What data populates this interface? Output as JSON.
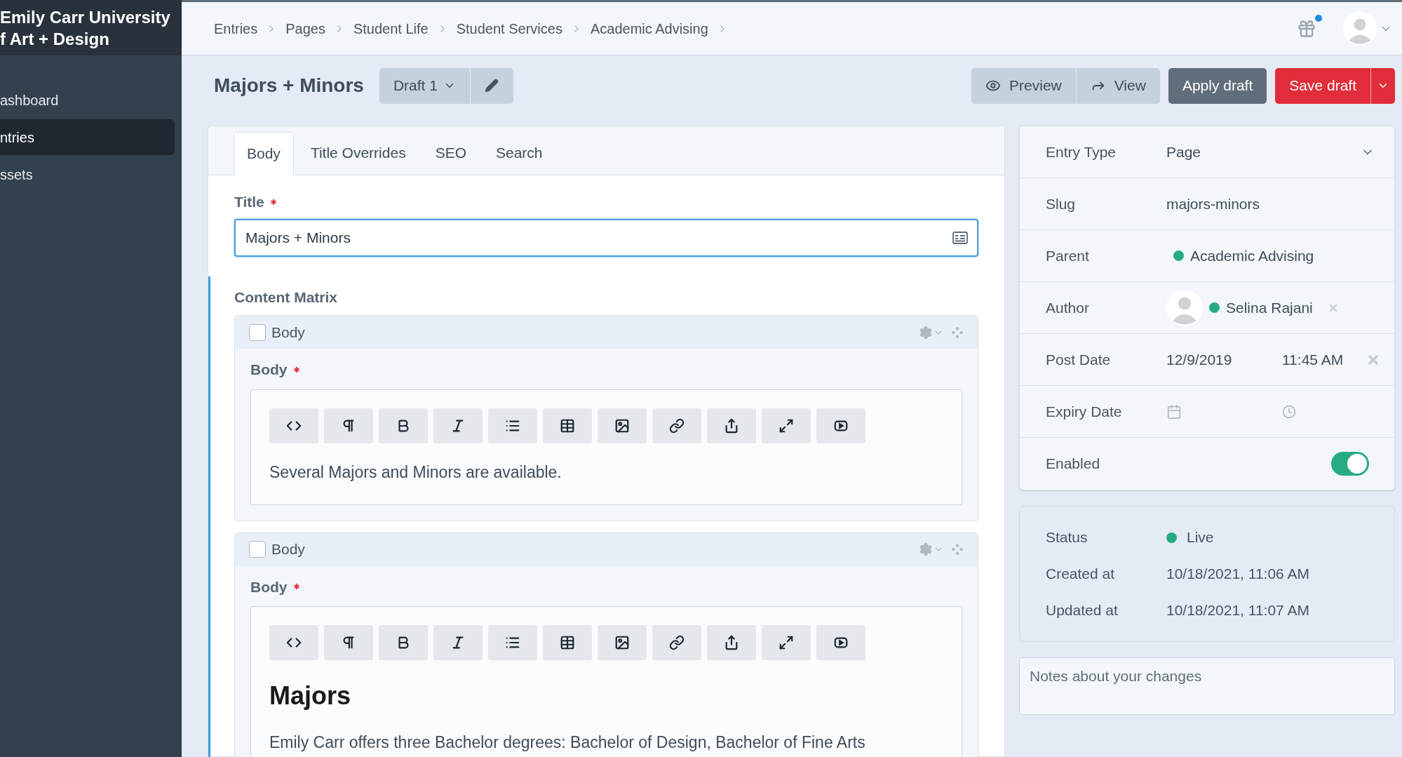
{
  "sidebar": {
    "site_name": [
      "Emily Carr University",
      "f Art + Design"
    ],
    "items": [
      {
        "label": "ashboard",
        "selected": false
      },
      {
        "label": "ntries",
        "selected": true
      },
      {
        "label": "ssets",
        "selected": false
      }
    ]
  },
  "breadcrumbs": [
    "Entries",
    "Pages",
    "Student Life",
    "Student Services",
    "Academic Advising"
  ],
  "entry": {
    "title": "Majors + Minors",
    "draft": "Draft 1"
  },
  "actions": [
    {
      "label": "Preview",
      "kind": "preview"
    },
    {
      "label": "View",
      "kind": "view"
    },
    {
      "label": "Apply draft",
      "kind": "apply"
    },
    {
      "label": "Save draft",
      "kind": "save"
    }
  ],
  "tabs": [
    {
      "label": "Body",
      "selected": true
    },
    {
      "label": "Title Overrides",
      "selected": false
    },
    {
      "label": "SEO",
      "selected": false
    },
    {
      "label": "Search",
      "selected": false
    }
  ],
  "title_field": {
    "label": "Title",
    "required": true,
    "value": "Majors + Minors"
  },
  "content_matrix": {
    "label": "Content Matrix",
    "blocks": [
      {
        "type_label": "Body",
        "checked": false,
        "field_label": "Body",
        "required": true,
        "content": [
          {
            "kind": "paragraph",
            "text": "Several Majors and Minors are available."
          }
        ]
      },
      {
        "type_label": "Body",
        "checked": false,
        "field_label": "Body",
        "required": true,
        "content": [
          {
            "kind": "heading",
            "text": "Majors"
          },
          {
            "kind": "paragraph",
            "text": "Emily Carr offers three Bachelor degrees: Bachelor of Design, Bachelor of Fine Arts"
          }
        ]
      }
    ]
  },
  "meta": [
    {
      "label": "Entry Type",
      "kind": "select",
      "value": "Page"
    },
    {
      "label": "Slug",
      "kind": "text",
      "value": "majors-minors"
    },
    {
      "label": "Parent",
      "kind": "element",
      "value": "Academic Advising",
      "color": "#27ab83"
    },
    {
      "label": "Author",
      "kind": "user",
      "value": "Selina Rajani",
      "color": "#27ab83"
    },
    {
      "label": "Post Date",
      "kind": "datetime",
      "date": "12/9/2019",
      "time": "11:45 AM"
    },
    {
      "label": "Expiry Date",
      "kind": "datetime"
    },
    {
      "label": "Enabled",
      "kind": "toggle",
      "on": true
    }
  ],
  "status": [
    {
      "label": "Status",
      "value": "Live",
      "color": "#27ab83"
    },
    {
      "label": "Created at",
      "value": "10/18/2021, 11:06 AM"
    },
    {
      "label": "Updated at",
      "value": "10/18/2021, 11:07 AM"
    }
  ],
  "notes": {
    "placeholder": "Notes about your changes"
  }
}
